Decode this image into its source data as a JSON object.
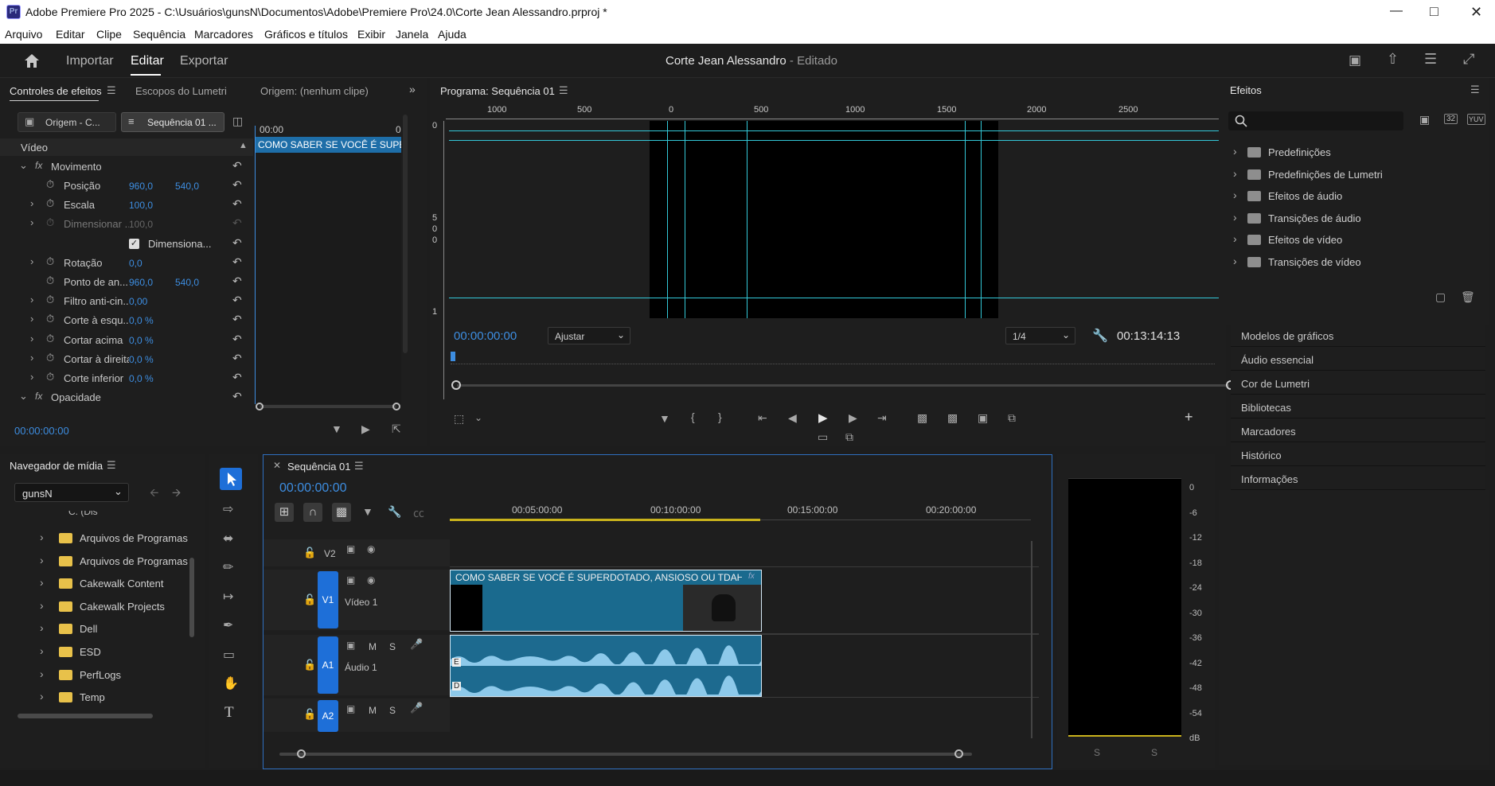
{
  "window": {
    "title": "Adobe Premiere Pro 2025 - C:\\Usuários\\gunsN\\Documentos\\Adobe\\Premiere Pro\\24.0\\Corte Jean Alessandro.prproj *",
    "app_badge": "Pr"
  },
  "menu": [
    "Arquivo",
    "Editar",
    "Clipe",
    "Sequência",
    "Marcadores",
    "Gráficos e títulos",
    "Exibir",
    "Janela",
    "Ajuda"
  ],
  "header": {
    "nav": [
      "Importar",
      "Editar",
      "Exportar"
    ],
    "active": "Editar",
    "project_name": "Corte Jean Alessandro",
    "project_status": " - Editado"
  },
  "effect_controls": {
    "tabs": [
      "Controles de efeitos",
      "Escopos do Lumetri",
      "Origem: (nenhum clipe)"
    ],
    "source_btn": "Origem - C...",
    "sequence_btn": "Sequência 01 ...",
    "timecode_start": "00:00",
    "timecode_end": "0",
    "clip_label": "COMO SABER SE VOCÊ É SUPERDOTADO",
    "section": "Vídeo",
    "group_motion": "Movimento",
    "group_opacity": "Opacidade",
    "props": [
      {
        "name": "Posição",
        "v1": "960,0",
        "v2": "540,0",
        "expand": false
      },
      {
        "name": "Escala",
        "v1": "100,0",
        "v2": "",
        "expand": true
      },
      {
        "name": "Dimensionar ...",
        "v1": "100,0",
        "v2": "",
        "expand": true,
        "dim": true
      },
      {
        "name": "Dimensiona...",
        "v1": "",
        "v2": "",
        "checkbox": true
      },
      {
        "name": "Rotação",
        "v1": "0,0",
        "v2": "",
        "expand": true
      },
      {
        "name": "Ponto de an...",
        "v1": "960,0",
        "v2": "540,0",
        "expand": false
      },
      {
        "name": "Filtro anti-cin...",
        "v1": "0,00",
        "v2": "",
        "expand": true
      },
      {
        "name": "Corte à esqu...",
        "v1": "0,0 %",
        "v2": "",
        "expand": true
      },
      {
        "name": "Cortar acima",
        "v1": "0,0 %",
        "v2": "",
        "expand": true
      },
      {
        "name": "Cortar à direita",
        "v1": "0,0 %",
        "v2": "",
        "expand": true
      },
      {
        "name": "Corte inferior",
        "v1": "0,0 %",
        "v2": "",
        "expand": true
      }
    ],
    "timecode": "00:00:00:00"
  },
  "program": {
    "title": "Programa: Sequência 01",
    "ruler": [
      "1000",
      "500",
      "0",
      "500",
      "1000",
      "1500",
      "2000",
      "2500"
    ],
    "vruler": [
      "0",
      "5",
      "0",
      "0",
      "1"
    ],
    "timecode": "00:00:00:00",
    "fit": "Ajustar",
    "resolution": "1/4",
    "duration": "00:13:14:13"
  },
  "effects_panel": {
    "title": "Efeitos",
    "badges": [
      "32",
      "YUV"
    ],
    "items": [
      "Predefinições",
      "Predefinições de Lumetri",
      "Efeitos de áudio",
      "Transições de áudio",
      "Efeitos de vídeo",
      "Transições de vídeo"
    ]
  },
  "side_panels": [
    "Modelos de gráficos",
    "Áudio essencial",
    "Cor de Lumetri",
    "Bibliotecas",
    "Marcadores",
    "Histórico",
    "Informações"
  ],
  "media_browser": {
    "title": "Navegador de mídia",
    "location": "gunsN",
    "top_item": "C: (Disco local)",
    "folders": [
      "Arquivos de Programas",
      "Arquivos de Programas (",
      "Cakewalk Content",
      "Cakewalk Projects",
      "Dell",
      "ESD",
      "PerfLogs",
      "Temp"
    ]
  },
  "timeline": {
    "tab": "Sequência 01",
    "timecode": "00:00:00:00",
    "ruler": [
      "00:05:00:00",
      "00:10:00:00",
      "00:15:00:00",
      "00:20:00:00"
    ],
    "tracks": [
      {
        "id": "V2",
        "name": ""
      },
      {
        "id": "V1",
        "name": "Vídeo 1"
      },
      {
        "id": "A1",
        "name": "Áudio 1"
      },
      {
        "id": "A2",
        "name": ""
      }
    ],
    "video_clip": "COMO SABER SE VOCÊ É SUPERDOTADO, ANSIOSO OU TDAH.m...",
    "mute": "M",
    "solo": "S",
    "audio_ch_left": "E",
    "audio_ch_right": "D"
  },
  "audio_meter": {
    "scale": [
      "0",
      "-6",
      "-12",
      "-18",
      "-24",
      "-30",
      "-36",
      "-42",
      "-48",
      "-54",
      "dB"
    ],
    "solo": [
      "S",
      "S"
    ]
  }
}
